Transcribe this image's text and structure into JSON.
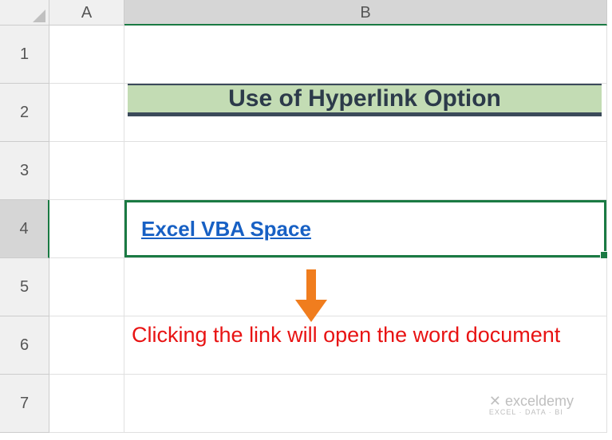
{
  "columns": [
    "A",
    "B"
  ],
  "rows": [
    "1",
    "2",
    "3",
    "4",
    "5",
    "6",
    "7"
  ],
  "title_cell": "Use of Hyperlink Option",
  "hyperlink_text": "Excel VBA Space",
  "annotation_text": "Clicking the link will open the word document",
  "watermark": {
    "top": "exceldemy",
    "bottom": "EXCEL · DATA · BI"
  },
  "selected_column": "B",
  "selected_row": "4",
  "chart_data": {
    "type": "table",
    "cells": [
      {
        "address": "B2",
        "value": "Use of Hyperlink Option",
        "style": "header"
      },
      {
        "address": "B4",
        "value": "Excel VBA Space",
        "style": "hyperlink"
      }
    ],
    "annotation": "Clicking the link will open the word document"
  }
}
